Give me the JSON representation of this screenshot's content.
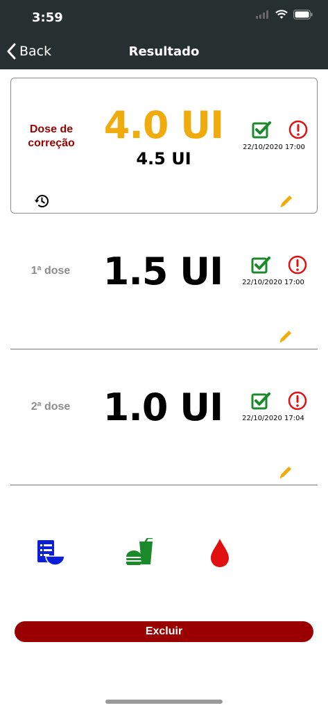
{
  "status_bar": {
    "time": "3:59"
  },
  "nav": {
    "back_label": "Back",
    "title": "Resultado"
  },
  "cards": [
    {
      "label": "Dose de correção",
      "value": "4.0 UI",
      "sub_value": "4.5 UI",
      "date": "22/10/2020 17:00"
    },
    {
      "label": "1ª dose",
      "value": "1.5 UI",
      "date": "22/10/2020 17:00"
    },
    {
      "label": "2ª dose",
      "value": "1.0 UI",
      "date": "22/10/2020 17:04"
    }
  ],
  "colors": {
    "nav_bg": "#273030",
    "correction_value": "#f0ac0d",
    "accent_red": "#9b0000",
    "check_green": "#1a8a2a",
    "alert_red": "#e01010",
    "edit_yellow": "#f0ac0d",
    "food_green": "#1a8a2a",
    "table_blue": "#0b1fd8",
    "blood_red": "#e01010"
  },
  "icons": {
    "back": "chevron-left-icon",
    "check": "checkbox-checked-icon",
    "alert": "alert-circle-icon",
    "edit": "pencil-icon",
    "history": "history-icon",
    "table": "table-bowl-icon",
    "food": "burger-drink-icon",
    "blood": "blood-drop-icon"
  },
  "actions": {
    "delete_label": "Excluir"
  }
}
